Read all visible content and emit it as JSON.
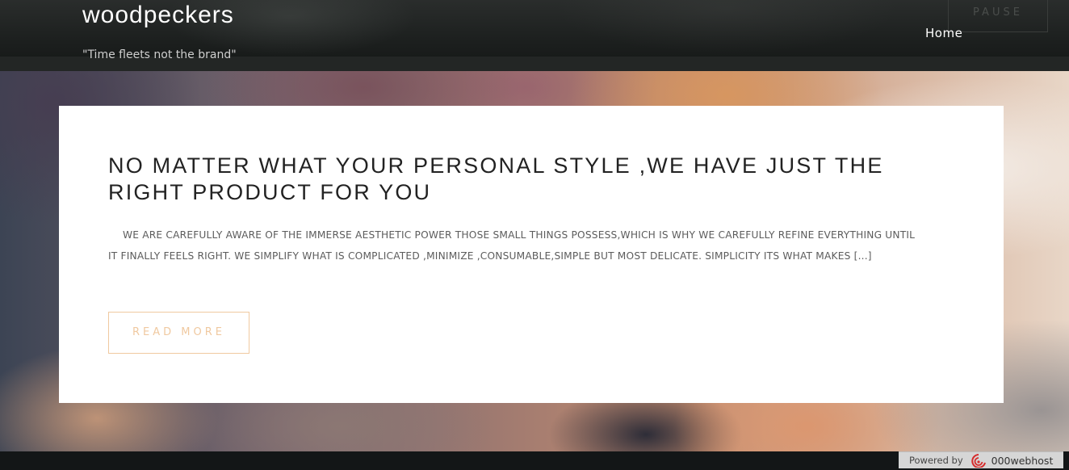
{
  "header": {
    "site_title": "woodpeckers",
    "tagline": "\"Time fleets not the brand\"",
    "pause_label": "PAUSE",
    "nav": {
      "home_label": "Home"
    }
  },
  "post": {
    "title": "NO MATTER WHAT YOUR PERSONAL STYLE ,WE HAVE JUST THE RIGHT PRODUCT FOR YOU",
    "excerpt": "WE ARE CAREFULLY AWARE OF THE IMMERSE AESTHETIC POWER THOSE SMALL THINGS POSSESS,WHICH IS WHY WE CAREFULLY REFINE EVERYTHING UNTIL IT FINALLY FEELS RIGHT. WE SIMPLIFY WHAT IS COMPLICATED ,MINIMIZE ,CONSUMABLE,SIMPLE BUT MOST DELICATE. SIMPLICITY ITS WHAT MAKES [...]",
    "read_more_label": "READ MORE"
  },
  "footer": {
    "powered_by_label": "Powered by",
    "host_name": "000webhost",
    "host_icon": "000webhost-logo-icon"
  },
  "colors": {
    "accent": "#f0c9a0",
    "header_bg": "#1d201f",
    "footer_bg": "#131617"
  }
}
